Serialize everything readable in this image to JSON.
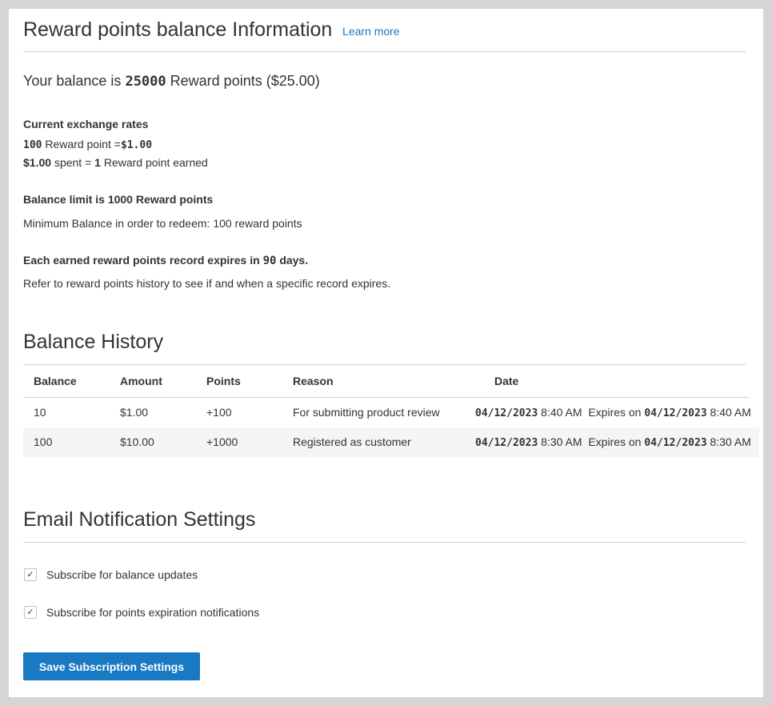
{
  "header": {
    "title": "Reward points balance Information",
    "learn_more": "Learn more"
  },
  "balance": {
    "prefix": "Your balance is",
    "points": "25000",
    "suffix": "Reward points ($25.00)"
  },
  "exchange": {
    "heading": "Current exchange rates",
    "rate1_points": "100",
    "rate1_text": "Reward point =",
    "rate1_value": "$1.00",
    "rate2_value": "$1.00",
    "rate2_text": "spent =",
    "rate2_points": "1",
    "rate2_suffix": "Reward point earned"
  },
  "limits": {
    "balance_limit": "Balance limit is 1000 Reward points",
    "minimum": "Minimum Balance in order to redeem: 100 reward points"
  },
  "expiry": {
    "heading_prefix": "Each earned reward points record expires in",
    "heading_days": "90",
    "heading_suffix": "days.",
    "note": "Refer to reward points history to see if and when a specific record expires."
  },
  "history": {
    "title": "Balance History",
    "columns": [
      "Balance",
      "Amount",
      "Points",
      "Reason",
      "Date"
    ],
    "rows": [
      {
        "balance": "10",
        "amount": "$1.00",
        "points": "+100",
        "reason": "For submitting product review",
        "date": "04/12/2023",
        "time": "8:40 AM",
        "expires_label": "Expires on",
        "expires_date": "04/12/2023",
        "expires_time": "8:40 AM"
      },
      {
        "balance": "100",
        "amount": "$10.00",
        "points": "+1000",
        "reason": "Registered as customer",
        "date": "04/12/2023",
        "time": "8:30 AM",
        "expires_label": "Expires on",
        "expires_date": "04/12/2023",
        "expires_time": "8:30 AM"
      }
    ]
  },
  "notifications": {
    "title": "Email Notification Settings",
    "options": [
      {
        "label": "Subscribe for balance updates",
        "checked": true
      },
      {
        "label": "Subscribe for points expiration notifications",
        "checked": true
      }
    ],
    "save_label": "Save Subscription Settings"
  },
  "colors": {
    "accent": "#1979c3",
    "background": "#d5d5d5",
    "panel": "#ffffff",
    "stripe": "#f5f5f5"
  }
}
